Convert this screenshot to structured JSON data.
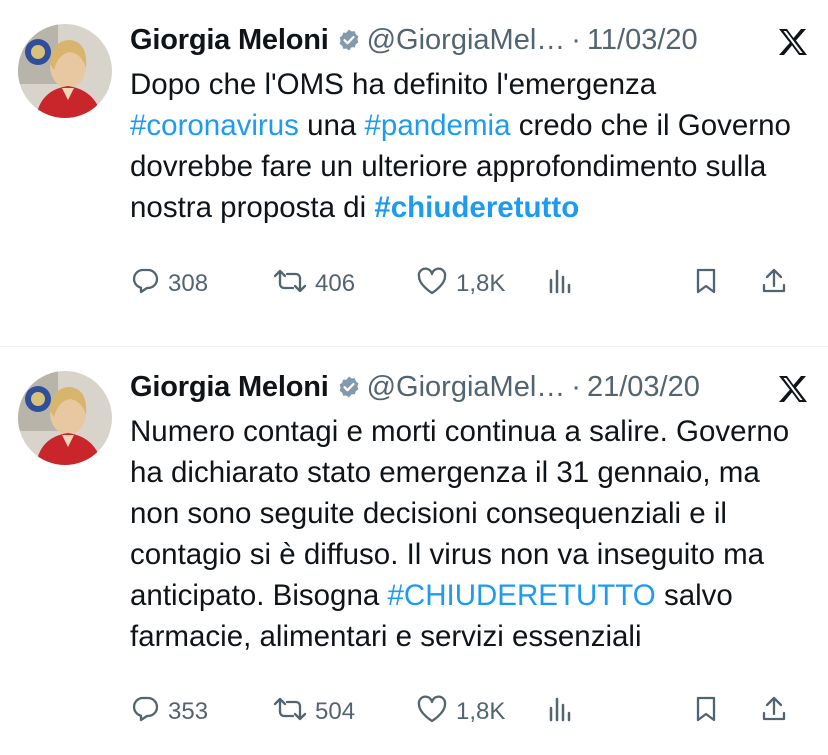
{
  "tweets": [
    {
      "name": "Giorgia Meloni",
      "handle": "@GiorgiaMel…",
      "separator": "·",
      "date": "11/03/20",
      "text": [
        {
          "t": "Dopo che l'OMS ha definito l'emergenza ",
          "type": "plain"
        },
        {
          "t": "#coronavirus",
          "type": "tag"
        },
        {
          "t": " una ",
          "type": "plain"
        },
        {
          "t": "#pandemia",
          "type": "tag"
        },
        {
          "t": " credo che il Governo dovrebbe fare un ulteriore approfondimento sulla nostra proposta di ",
          "type": "plain"
        },
        {
          "t": "#chiuderetutto",
          "type": "tag-bold"
        }
      ],
      "replies": "308",
      "retweets": "406",
      "likes": "1,8K"
    },
    {
      "name": "Giorgia Meloni",
      "handle": "@GiorgiaMel…",
      "separator": "·",
      "date": "21/03/20",
      "text": [
        {
          "t": "Numero contagi e morti continua a salire. Governo ha dichiarato stato emergenza il 31 gennaio, ma non sono seguite decisioni consequenziali e il contagio si è diffuso. Il virus non va inseguito ma anticipato. Bisogna ",
          "type": "plain"
        },
        {
          "t": "#CHIUDERETUTTO",
          "type": "tag"
        },
        {
          "t": " salvo farmacie, alimentari e servizi essenziali",
          "type": "plain"
        }
      ],
      "replies": "353",
      "retweets": "504",
      "likes": "1,8K"
    }
  ],
  "icons": {
    "verified": "verified-badge-icon",
    "x": "x-logo-icon",
    "reply": "reply-icon",
    "retweet": "retweet-icon",
    "like": "heart-icon",
    "views": "views-icon",
    "bookmark": "bookmark-icon",
    "share": "share-icon"
  },
  "colors": {
    "link": "#1d9bf0",
    "secondary": "#536471",
    "text": "#0f1419"
  }
}
